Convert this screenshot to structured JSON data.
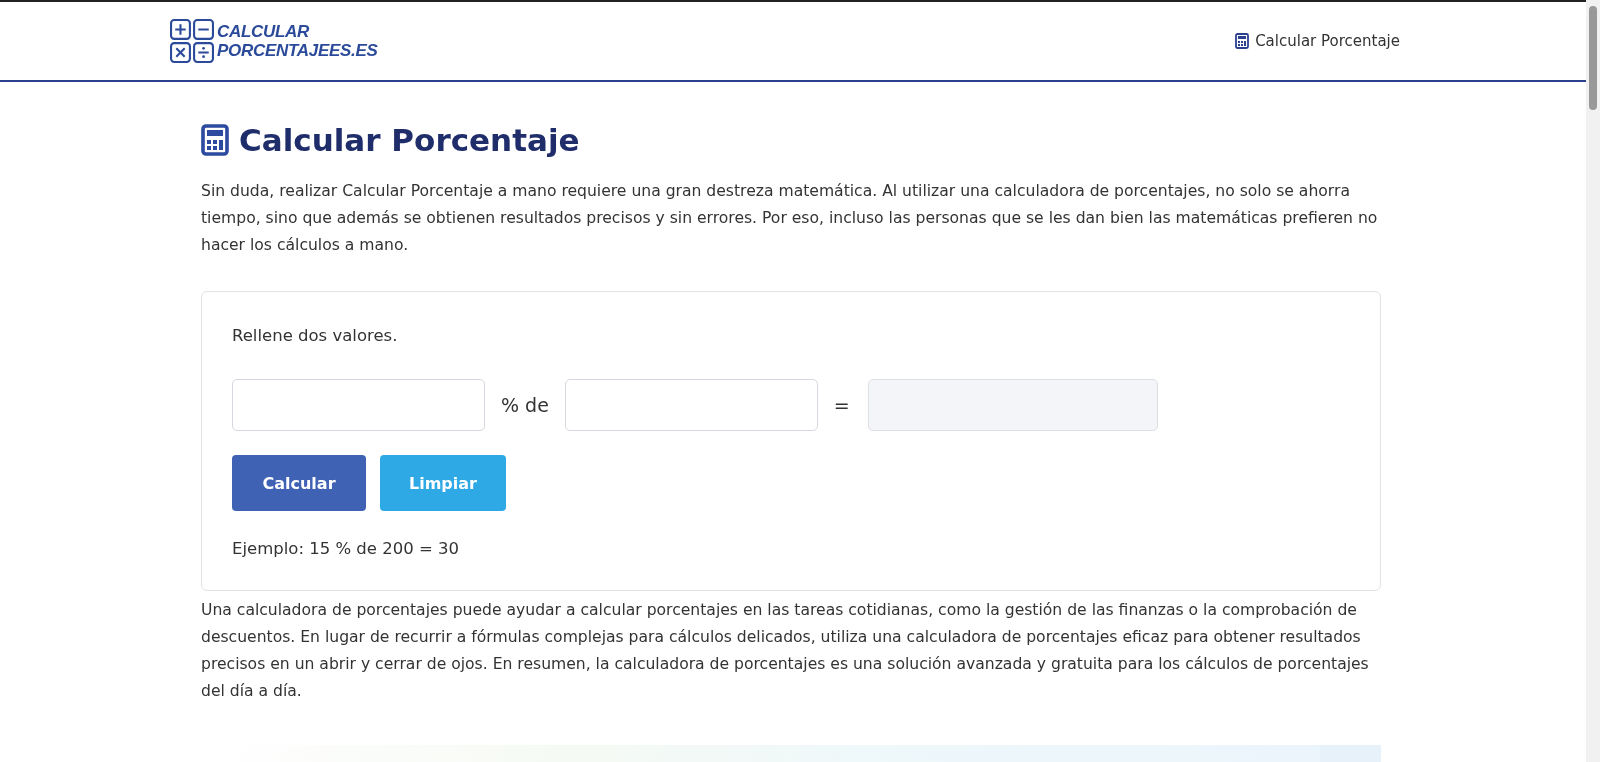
{
  "header": {
    "logo_lines": [
      "CALCULAR",
      "PORCENTAJEES.ES"
    ],
    "nav_link": "Calcular Porcentaje"
  },
  "title": "Calcular Porcentaje",
  "intro": "Sin duda, realizar Calcular Porcentaje a mano requiere una gran destreza matemática. Al utilizar una calculadora de porcentajes, no solo se ahorra tiempo, sino que además se obtienen resultados precisos y sin errores. Por eso, incluso las personas que se les dan bien las matemáticas prefieren no hacer los cálculos a mano.",
  "calculator": {
    "instruction": "Rellene dos valores.",
    "percent_label": "% de",
    "equals_label": "=",
    "result_disabled": true,
    "buttons": [
      {
        "label": "Calcular",
        "kind": "primary"
      },
      {
        "label": "Limpiar",
        "kind": "secondary"
      }
    ],
    "example": "Ejemplo: 15 % de 200 = 30"
  },
  "outro": "Una calculadora de porcentajes puede ayudar a calcular porcentajes en las tareas cotidianas, como la gestión de las finanzas o la comprobación de descuentos. En lugar de recurrir a fórmulas complejas para cálculos delicados, utiliza una calculadora de porcentajes eficaz para obtener resultados precisos en un abrir y cerrar de ojos. En resumen, la calculadora de porcentajes es una solución avanzada y gratuita para los cálculos de porcentajes del día a día."
}
